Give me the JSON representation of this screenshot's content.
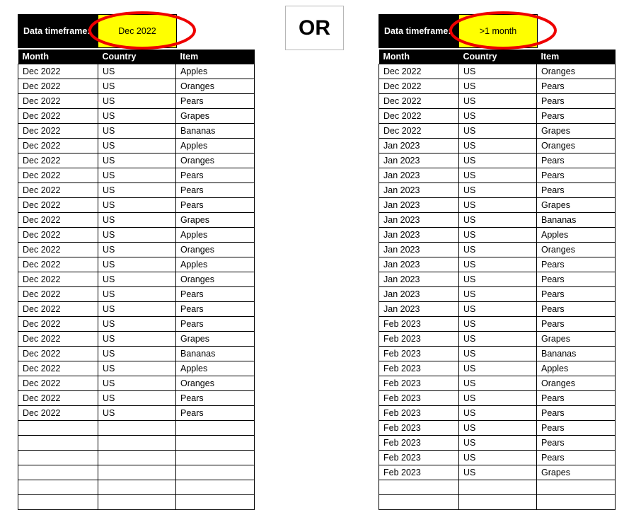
{
  "separator": {
    "label": "OR"
  },
  "colors": {
    "header_bg": "#000000",
    "header_text": "#ffffff",
    "highlight_fill": "#ffff00",
    "annotation_stroke": "#ee0000",
    "grid_line": "#000000",
    "or_box_border": "#b7b7b7"
  },
  "columns": [
    "Month",
    "Country",
    "Item"
  ],
  "panels": [
    {
      "id": "left",
      "timeframe_label": "Data timeframe:",
      "timeframe_value": "Dec 2022",
      "columns": [
        "Month",
        "Country",
        "Item"
      ],
      "rows": [
        [
          "Dec 2022",
          "US",
          "Apples"
        ],
        [
          "Dec 2022",
          "US",
          "Oranges"
        ],
        [
          "Dec 2022",
          "US",
          "Pears"
        ],
        [
          "Dec 2022",
          "US",
          "Grapes"
        ],
        [
          "Dec 2022",
          "US",
          "Bananas"
        ],
        [
          "Dec 2022",
          "US",
          "Apples"
        ],
        [
          "Dec 2022",
          "US",
          "Oranges"
        ],
        [
          "Dec 2022",
          "US",
          "Pears"
        ],
        [
          "Dec 2022",
          "US",
          "Pears"
        ],
        [
          "Dec 2022",
          "US",
          "Pears"
        ],
        [
          "Dec 2022",
          "US",
          "Grapes"
        ],
        [
          "Dec 2022",
          "US",
          "Apples"
        ],
        [
          "Dec 2022",
          "US",
          "Oranges"
        ],
        [
          "Dec 2022",
          "US",
          "Apples"
        ],
        [
          "Dec 2022",
          "US",
          "Oranges"
        ],
        [
          "Dec 2022",
          "US",
          "Pears"
        ],
        [
          "Dec 2022",
          "US",
          "Pears"
        ],
        [
          "Dec 2022",
          "US",
          "Pears"
        ],
        [
          "Dec 2022",
          "US",
          "Grapes"
        ],
        [
          "Dec 2022",
          "US",
          "Bananas"
        ],
        [
          "Dec 2022",
          "US",
          "Apples"
        ],
        [
          "Dec 2022",
          "US",
          "Oranges"
        ],
        [
          "Dec 2022",
          "US",
          "Pears"
        ],
        [
          "Dec 2022",
          "US",
          "Pears"
        ],
        [
          "",
          "",
          ""
        ],
        [
          "",
          "",
          ""
        ],
        [
          "",
          "",
          ""
        ],
        [
          "",
          "",
          ""
        ],
        [
          "",
          "",
          ""
        ],
        [
          "",
          "",
          ""
        ]
      ]
    },
    {
      "id": "right",
      "timeframe_label": "Data timeframe:",
      "timeframe_value": ">1 month",
      "columns": [
        "Month",
        "Country",
        "Item"
      ],
      "rows": [
        [
          "Dec 2022",
          "US",
          "Oranges"
        ],
        [
          "Dec 2022",
          "US",
          "Pears"
        ],
        [
          "Dec 2022",
          "US",
          "Pears"
        ],
        [
          "Dec 2022",
          "US",
          "Pears"
        ],
        [
          "Dec 2022",
          "US",
          "Grapes"
        ],
        [
          "Jan 2023",
          "US",
          "Oranges"
        ],
        [
          "Jan 2023",
          "US",
          "Pears"
        ],
        [
          "Jan 2023",
          "US",
          "Pears"
        ],
        [
          "Jan 2023",
          "US",
          "Pears"
        ],
        [
          "Jan 2023",
          "US",
          "Grapes"
        ],
        [
          "Jan 2023",
          "US",
          "Bananas"
        ],
        [
          "Jan 2023",
          "US",
          "Apples"
        ],
        [
          "Jan 2023",
          "US",
          "Oranges"
        ],
        [
          "Jan 2023",
          "US",
          "Pears"
        ],
        [
          "Jan 2023",
          "US",
          "Pears"
        ],
        [
          "Jan 2023",
          "US",
          "Pears"
        ],
        [
          "Jan 2023",
          "US",
          "Pears"
        ],
        [
          "Feb 2023",
          "US",
          "Pears"
        ],
        [
          "Feb 2023",
          "US",
          "Grapes"
        ],
        [
          "Feb 2023",
          "US",
          "Bananas"
        ],
        [
          "Feb 2023",
          "US",
          "Apples"
        ],
        [
          "Feb 2023",
          "US",
          "Oranges"
        ],
        [
          "Feb 2023",
          "US",
          "Pears"
        ],
        [
          "Feb 2023",
          "US",
          "Pears"
        ],
        [
          "Feb 2023",
          "US",
          "Pears"
        ],
        [
          "Feb 2023",
          "US",
          "Pears"
        ],
        [
          "Feb 2023",
          "US",
          "Pears"
        ],
        [
          "Feb 2023",
          "US",
          "Grapes"
        ],
        [
          "",
          "",
          ""
        ],
        [
          "",
          "",
          ""
        ]
      ]
    }
  ]
}
